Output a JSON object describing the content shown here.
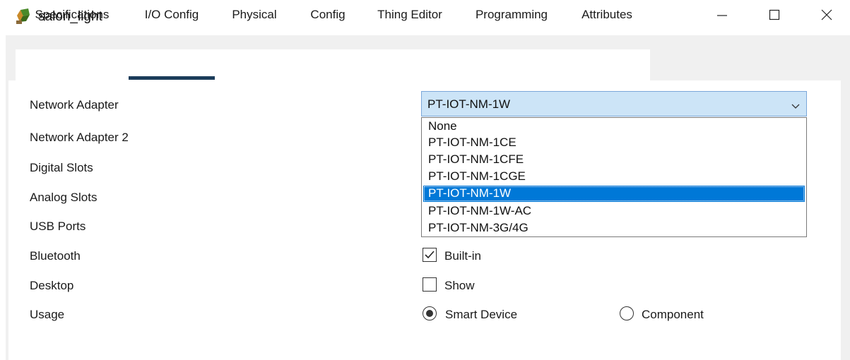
{
  "window": {
    "title": "salon_light",
    "icon": "device-icon"
  },
  "tabs": [
    {
      "label": "Specifications",
      "active": false
    },
    {
      "label": "I/O Config",
      "active": true
    },
    {
      "label": "Physical",
      "active": false
    },
    {
      "label": "Config",
      "active": false
    },
    {
      "label": "Thing Editor",
      "active": false
    },
    {
      "label": "Programming",
      "active": false
    },
    {
      "label": "Attributes",
      "active": false
    }
  ],
  "form": {
    "labels": {
      "network_adapter": "Network Adapter",
      "network_adapter_2": "Network Adapter 2",
      "digital_slots": "Digital Slots",
      "analog_slots": "Analog Slots",
      "usb_ports": "USB Ports",
      "bluetooth": "Bluetooth",
      "desktop": "Desktop",
      "usage": "Usage"
    },
    "network_adapter": {
      "selected": "PT-IOT-NM-1W",
      "options": [
        "None",
        "PT-IOT-NM-1CE",
        "PT-IOT-NM-1CFE",
        "PT-IOT-NM-1CGE",
        "PT-IOT-NM-1W",
        "PT-IOT-NM-1W-AC",
        "PT-IOT-NM-3G/4G"
      ],
      "highlighted_index": 4
    },
    "bluetooth": {
      "label": "Built-in",
      "checked": true
    },
    "desktop": {
      "label": "Show",
      "checked": false
    },
    "usage": {
      "smart_device": {
        "label": "Smart Device",
        "selected": true
      },
      "component": {
        "label": "Component",
        "selected": false
      }
    }
  },
  "colors": {
    "combo_bg": "#cce4f7",
    "selection": "#0078d7",
    "tab_underline": "#1c3c5a"
  }
}
